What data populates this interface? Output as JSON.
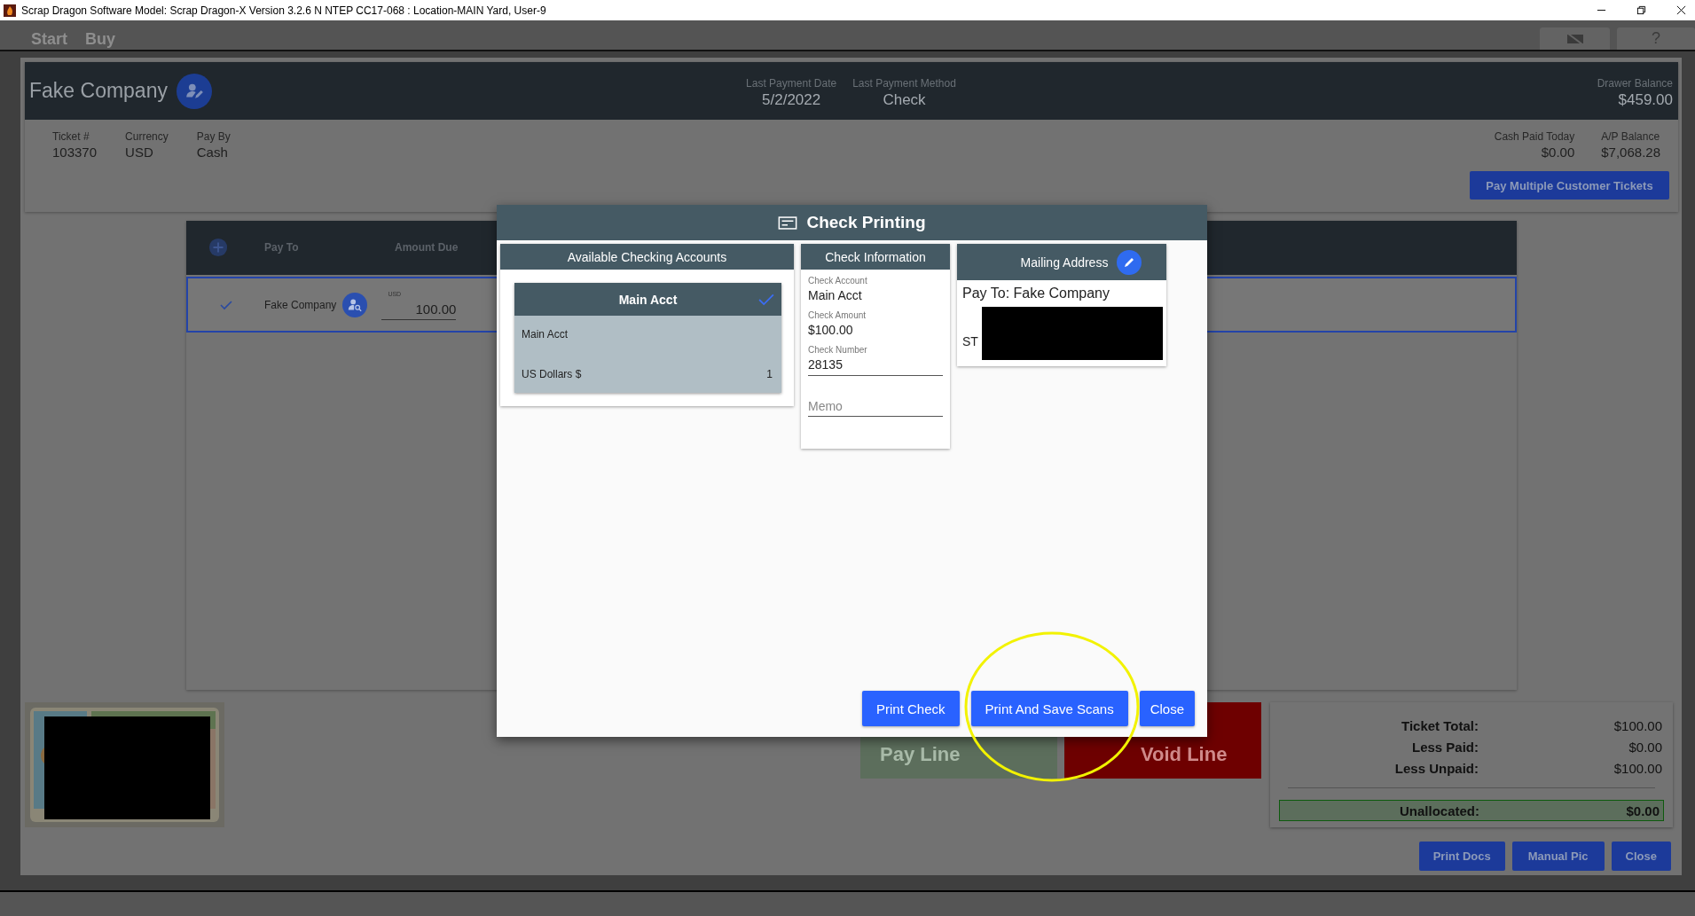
{
  "window": {
    "title": "Scrap Dragon Software Model: Scrap Dragon-X Version 3.2.6 N NTEP CC17-068 : Location-MAIN Yard, User-9"
  },
  "menu": [
    {
      "label": "Start"
    },
    {
      "label": "Buy"
    }
  ],
  "toolbar": {
    "help": "?"
  },
  "customer": {
    "name": "Fake Company",
    "summary": [
      {
        "label": "Last Payment Date",
        "value": "5/2/2022"
      },
      {
        "label": "Last Payment Method",
        "value": "Check"
      }
    ],
    "drawer_balance": {
      "label": "Drawer Balance",
      "value": "$459.00"
    }
  },
  "ticket_fields": [
    {
      "label": "Ticket #",
      "value": "103370"
    },
    {
      "label": "Currency",
      "value": "USD"
    },
    {
      "label": "Pay By",
      "value": "Cash"
    }
  ],
  "balances": [
    {
      "label": "Cash Paid Today",
      "value": "$0.00"
    },
    {
      "label": "A/P Balance",
      "value": "$7,068.28"
    }
  ],
  "pay_multiple_button": "Pay Multiple Customer Tickets",
  "table": {
    "columns": [
      "Pay To",
      "Amount Due"
    ],
    "rows": [
      {
        "selected": true,
        "checked": true,
        "pay_to": "Fake Company",
        "currency": "USD",
        "amount": "100.00"
      }
    ]
  },
  "line_buttons": [
    {
      "kind": "pay",
      "label": "Pay Line"
    },
    {
      "kind": "void",
      "label": "Void Line"
    }
  ],
  "totals": {
    "rows": [
      {
        "label": "Ticket Total:",
        "value": "$100.00"
      },
      {
        "label": "Less Paid:",
        "value": "$0.00"
      },
      {
        "label": "Less Unpaid:",
        "value": "$100.00"
      }
    ],
    "unallocated": {
      "label": "Unallocated:",
      "value": "$0.00"
    }
  },
  "footer_buttons": [
    "Print Docs",
    "Manual Pic",
    "Close"
  ],
  "dialog": {
    "title": "Check Printing",
    "accounts": {
      "heading": "Available Checking Accounts",
      "items": [
        {
          "name": "Main Acct",
          "selected": true,
          "description": "Main Acct",
          "currency": "US Dollars $",
          "count": "1"
        }
      ]
    },
    "check_info": {
      "heading": "Check Information",
      "fields": [
        {
          "kind": "text",
          "label": "Check Account",
          "value": "Main Acct"
        },
        {
          "kind": "text",
          "label": "Check Amount",
          "value": "$100.00"
        },
        {
          "kind": "input",
          "label": "Check Number",
          "value": "28135"
        }
      ],
      "memo": {
        "placeholder": "Memo"
      }
    },
    "mailing": {
      "heading": "Mailing Address",
      "pay_to": "Pay To: Fake Company",
      "address_line": "ST"
    },
    "buttons": [
      {
        "label": "Print Check"
      },
      {
        "label": "Print And Save Scans"
      },
      {
        "label": "Close"
      }
    ]
  }
}
